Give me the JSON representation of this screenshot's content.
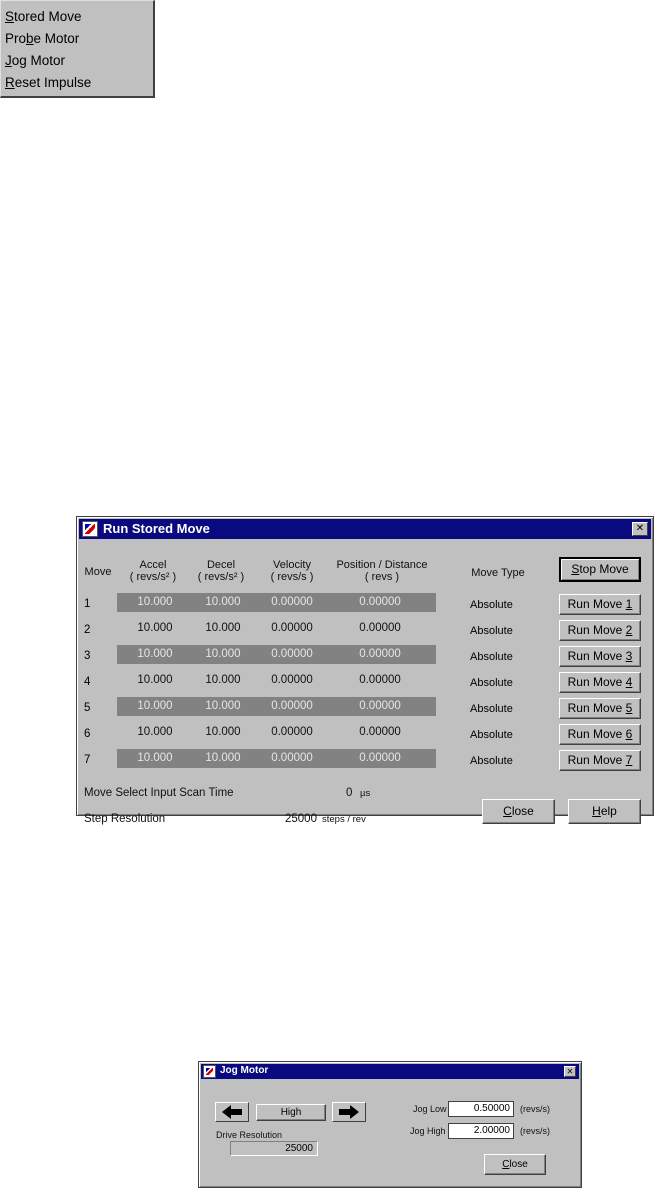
{
  "context_menu": {
    "items": [
      {
        "pre": "",
        "key": "S",
        "post": "tored Move"
      },
      {
        "pre": "Pro",
        "key": "b",
        "post": "e Motor"
      },
      {
        "pre": "",
        "key": "J",
        "post": "og Motor"
      },
      {
        "pre": "",
        "key": "R",
        "post": "eset Impulse"
      }
    ]
  },
  "run_dialog": {
    "title": "Run Stored Move",
    "close_glyph": "✕",
    "headers": {
      "move": "Move",
      "accel": "Accel",
      "accel_unit": "( revs/s² )",
      "decel": "Decel",
      "decel_unit": "( revs/s² )",
      "velocity": "Velocity",
      "velocity_unit": "( revs/s )",
      "position": "Position / Distance",
      "position_unit": "( revs )",
      "move_type": "Move Type"
    },
    "stop_button": {
      "pre": "",
      "key": "S",
      "post": "top Move"
    },
    "rows": [
      {
        "num": "1",
        "accel": "10.000",
        "decel": "10.000",
        "velocity": "0.00000",
        "position": "0.00000",
        "type": "Absolute",
        "btn_pre": "Run Move ",
        "btn_key": "1"
      },
      {
        "num": "2",
        "accel": "10.000",
        "decel": "10.000",
        "velocity": "0.00000",
        "position": "0.00000",
        "type": "Absolute",
        "btn_pre": "Run Move ",
        "btn_key": "2"
      },
      {
        "num": "3",
        "accel": "10.000",
        "decel": "10.000",
        "velocity": "0.00000",
        "position": "0.00000",
        "type": "Absolute",
        "btn_pre": "Run Move ",
        "btn_key": "3"
      },
      {
        "num": "4",
        "accel": "10.000",
        "decel": "10.000",
        "velocity": "0.00000",
        "position": "0.00000",
        "type": "Absolute",
        "btn_pre": "Run Move ",
        "btn_key": "4"
      },
      {
        "num": "5",
        "accel": "10.000",
        "decel": "10.000",
        "velocity": "0.00000",
        "position": "0.00000",
        "type": "Absolute",
        "btn_pre": "Run Move ",
        "btn_key": "5"
      },
      {
        "num": "6",
        "accel": "10.000",
        "decel": "10.000",
        "velocity": "0.00000",
        "position": "0.00000",
        "type": "Absolute",
        "btn_pre": "Run Move ",
        "btn_key": "6"
      },
      {
        "num": "7",
        "accel": "10.000",
        "decel": "10.000",
        "velocity": "0.00000",
        "position": "0.00000",
        "type": "Absolute",
        "btn_pre": "Run Move ",
        "btn_key": "7"
      }
    ],
    "scan_time_label": "Move Select Input Scan Time",
    "scan_time_value": "0",
    "scan_time_unit": "µs",
    "step_res_label": "Step Resolution",
    "step_res_value": "25000",
    "step_res_unit": "steps / rev",
    "close_button": {
      "pre": "",
      "key": "C",
      "post": "lose"
    },
    "help_button": {
      "pre": "",
      "key": "H",
      "post": "elp"
    }
  },
  "jog_dialog": {
    "title": "Jog Motor",
    "close_glyph": "✕",
    "speed_label": "High",
    "jog_low_label": "Jog Low",
    "jog_low_value": "0.50000",
    "jog_low_unit": "(revs/s)",
    "jog_high_label": "Jog High",
    "jog_high_value": "2.00000",
    "jog_high_unit": "(revs/s)",
    "drive_res_label": "Drive Resolution",
    "drive_res_value": "25000",
    "close_button": {
      "pre": "",
      "key": "C",
      "post": "lose"
    }
  }
}
